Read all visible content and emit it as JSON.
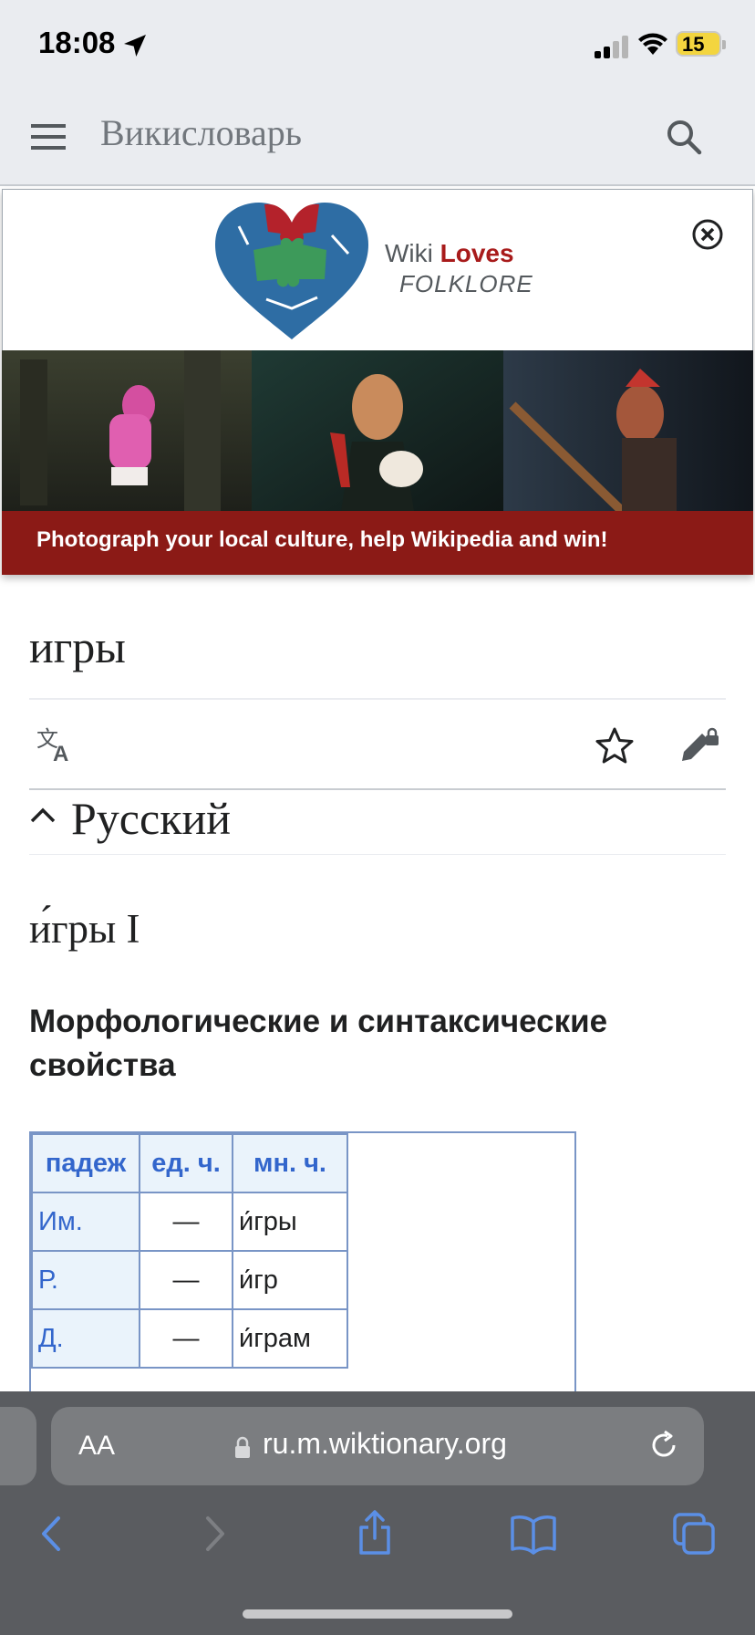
{
  "status_bar": {
    "time": "18:08",
    "battery": "15"
  },
  "header": {
    "site_title": "Викисловарь"
  },
  "banner": {
    "logo_line1_a": "Wiki",
    "logo_line1_b": "Loves",
    "logo_line2": "FOLKLORE",
    "caption": "Photograph your local culture, help Wikipedia and win!"
  },
  "page": {
    "title": "игры",
    "language_heading": "Русский",
    "word_heading": "и́гры I",
    "section_heading": "Морфологические и синтаксические свойства"
  },
  "declension_table": {
    "headers": [
      "падеж",
      "ед. ч.",
      "мн. ч."
    ],
    "rows": [
      [
        "Им.",
        "—",
        "и́гры"
      ],
      [
        "Р.",
        "—",
        "и́гр"
      ],
      [
        "Д.",
        "—",
        "и́грам"
      ]
    ]
  },
  "browser": {
    "text_size_button": "AA",
    "url": "ru.m.wiktionary.org"
  },
  "colors": {
    "link_blue": "#3366cc",
    "banner_red": "#8b1a16",
    "table_border": "#7995c6",
    "safari_toolbar": "#5a5c60",
    "safari_icon_blue": "#5b8fe6"
  }
}
